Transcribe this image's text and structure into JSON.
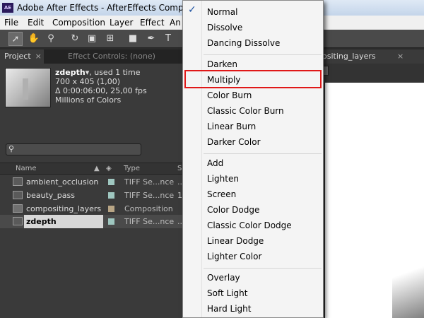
{
  "window": {
    "title": "Adobe After Effects - AfterEffects Compositin",
    "logo": "AE"
  },
  "menubar": [
    "File",
    "Edit",
    "Composition",
    "Layer",
    "Effect",
    "An"
  ],
  "toolbar": {
    "tools": [
      "selection-tool",
      "hand-tool",
      "zoom-tool",
      "rotate-tool",
      "camera-tool",
      "pan-behind-tool",
      "rectangle-tool",
      "pen-tool",
      "type-tool"
    ]
  },
  "tabs": {
    "project": "Project",
    "effect_controls": "Effect Controls: (none)",
    "viewer": "ositing_layers",
    "close": "×"
  },
  "project": {
    "selected_name": "zdepth",
    "used": ", used 1 time",
    "dimensions": "700 x 405 (1,00)",
    "duration": "Δ 0:00:06:00, 25,00 fps",
    "colors": "Millions of Colors",
    "search_placeholder": "",
    "columns": {
      "name": "Name",
      "type": "Type",
      "size": "S"
    },
    "items": [
      {
        "name": "ambient_occlusion",
        "type": "TIFF Se...nce",
        "size": "...",
        "swatch": "#9fc7c0"
      },
      {
        "name": "beauty_pass",
        "type": "TIFF Se...nce",
        "size": "1",
        "swatch": "#9fc7c0"
      },
      {
        "name": "compositing_layers",
        "type": "Composition",
        "size": "",
        "swatch": "#b8a585"
      },
      {
        "name": "zdepth",
        "type": "TIFF Se...nce",
        "size": "...",
        "swatch": "#9fc7c0"
      }
    ]
  },
  "blend_menu": {
    "groups": [
      [
        "Normal",
        "Dissolve",
        "Dancing Dissolve"
      ],
      [
        "Darken",
        "Multiply",
        "Color Burn",
        "Classic Color Burn",
        "Linear Burn",
        "Darker Color"
      ],
      [
        "Add",
        "Lighten",
        "Screen",
        "Color Dodge",
        "Classic Color Dodge",
        "Linear Dodge",
        "Lighter Color"
      ],
      [
        "Overlay",
        "Soft Light",
        "Hard Light"
      ]
    ],
    "checked": "Normal",
    "highlighted": "Multiply",
    "check_glyph": "✓"
  },
  "colors": {
    "highlight": "#e01818",
    "menu_bg": "#f4f4f4",
    "check": "#1a4fa0"
  }
}
